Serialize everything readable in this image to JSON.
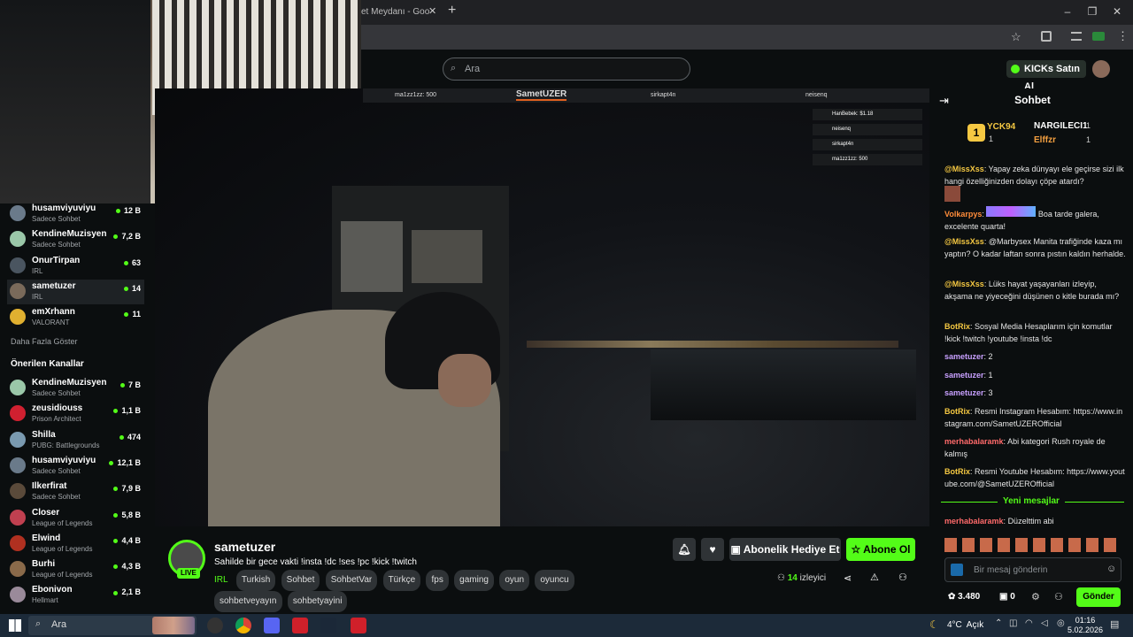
{
  "browser": {
    "tab_title": "et Meydanı - Goo",
    "new_tab": "+",
    "min": "–",
    "restore": "❐",
    "close": "✕"
  },
  "header": {
    "search_placeholder": "Ara",
    "buy_kicks": "KICKs Satın Al"
  },
  "overlay": {
    "left": "ma1zz1zz: 500",
    "brand": "SametUZER",
    "mid": "sirkapt4n",
    "right": "neisenq",
    "list": [
      "HanBebek: $1.18",
      "neisenq",
      "sirkapt4n",
      "ma1zz1zz: 500"
    ]
  },
  "sidebar": {
    "channels": [
      {
        "name": "husamviyuviyu",
        "cat": "Sadece Sohbet",
        "viewers": "12 B",
        "color": "#6a7a8a"
      },
      {
        "name": "KendineMuzisyen",
        "cat": "Sadece Sohbet",
        "viewers": "7,2 B",
        "color": "#9ac7a8"
      },
      {
        "name": "OnurTirpan",
        "cat": "IRL",
        "viewers": "63",
        "color": "#4a5560"
      },
      {
        "name": "sametuzer",
        "cat": "IRL",
        "viewers": "14",
        "color": "#7a6a5a"
      },
      {
        "name": "emXrhann",
        "cat": "VALORANT",
        "viewers": "11",
        "color": "#e0b030"
      }
    ],
    "show_more": "Daha Fazla Göster",
    "suggested_title": "Önerilen Kanallar",
    "suggested": [
      {
        "name": "KendineMuzisyen",
        "cat": "Sadece Sohbet",
        "viewers": "7 B",
        "color": "#9ac7a8"
      },
      {
        "name": "zeusidiouss",
        "cat": "Prison Architect",
        "viewers": "1,1 B",
        "color": "#d02030"
      },
      {
        "name": "Shilla",
        "cat": "PUBG: Battlegrounds",
        "viewers": "474",
        "color": "#7a9ab0"
      },
      {
        "name": "husamviyuviyu",
        "cat": "Sadece Sohbet",
        "viewers": "12,1 B",
        "color": "#6a7a8a"
      },
      {
        "name": "Ilkerfirat",
        "cat": "Sadece Sohbet",
        "viewers": "7,9 B",
        "color": "#5a4a3a"
      },
      {
        "name": "Closer",
        "cat": "League of Legends",
        "viewers": "5,8 B",
        "color": "#c04050"
      },
      {
        "name": "Elwind",
        "cat": "League of Legends",
        "viewers": "4,4 B",
        "color": "#b03020"
      },
      {
        "name": "Burhi",
        "cat": "League of Legends",
        "viewers": "4,3 B",
        "color": "#8a6a4a"
      },
      {
        "name": "Ebonivon",
        "cat": "Hellmart",
        "viewers": "2,1 B",
        "color": "#9a8a9a"
      }
    ]
  },
  "stream": {
    "channel": "sametuzer",
    "live": "LIVE",
    "title": "Sahilde bir gece vakti !insta !dc !ses !pc !kick !twitch",
    "category": "IRL",
    "tags": [
      "Turkish",
      "Sohbet",
      "SohbetVar",
      "Türkçe",
      "fps",
      "gaming",
      "oyun",
      "oyuncu",
      "sohbetveyayın",
      "sohbetyayini"
    ],
    "gift_sub": "Abonelik Hediye Et",
    "subscribe": "Abone Ol",
    "viewers": "14",
    "viewers_label": "izleyici"
  },
  "chat": {
    "title": "Sohbet",
    "leaders": [
      {
        "rank": "1",
        "name": "YCK94",
        "count": "1"
      },
      {
        "name": "NARGILECI1",
        "count": "1"
      },
      {
        "name": "Elffzr",
        "count": "1"
      }
    ],
    "messages": [
      {
        "user": "@MissXss",
        "color": "#f5c842",
        "text": "Yapay zeka dünyayı ele geçirse sizi ilk hangi özelliğinizden dolayı çöpe atardı?"
      },
      {
        "user": "Volkarpys",
        "color": "#ff8c3a",
        "text": "Boa tarde galera, excelente quarta!"
      },
      {
        "user": "@MissXss",
        "color": "#f5c842",
        "text": "@Marbysex Manita trafiğinde kaza mı yaptın? O kadar laftan sonra pıstın kaldın herhalde."
      },
      {
        "user": "@MissXss",
        "color": "#f5c842",
        "text": "Lüks hayat yaşayanları izleyip, akşama ne yiyeceğini düşünen o kitle burada mı?"
      },
      {
        "user": "BotRix",
        "color": "#f5c842",
        "text": "Sosyal Media Hesaplarım için komutlar !kick !twitch !youtube !insta !dc"
      },
      {
        "user": "sametuzer",
        "color": "#c8a0ff",
        "text": "2"
      },
      {
        "user": "sametuzer",
        "color": "#c8a0ff",
        "text": "1"
      },
      {
        "user": "sametuzer",
        "color": "#c8a0ff",
        "text": "3"
      },
      {
        "user": "BotRix",
        "color": "#f5c842",
        "text": "Resmi Instagram Hesabım: https://www.instagram.com/SametUZEROfficial"
      },
      {
        "user": "merhabalaramk",
        "color": "#ff6a6a",
        "text": "Abi kategori Rush royale de kalmış"
      },
      {
        "user": "BotRix",
        "color": "#f5c842",
        "text": "Resmi Youtube Hesabım: https://www.youtube.com/@SametUZEROfficial"
      }
    ],
    "new_messages": "Yeni mesajlar",
    "last_message": {
      "user": "merhabalaramk",
      "color": "#ff6a6a",
      "text": "Düzelttim abi"
    },
    "input_placeholder": "Bir mesaj gönderin",
    "points": "3.480",
    "gift_count": "0",
    "send": "Gönder"
  },
  "taskbar": {
    "search": "Ara",
    "weather": "4°C  Açık",
    "time": "01:16",
    "date": "5.02.2026"
  }
}
